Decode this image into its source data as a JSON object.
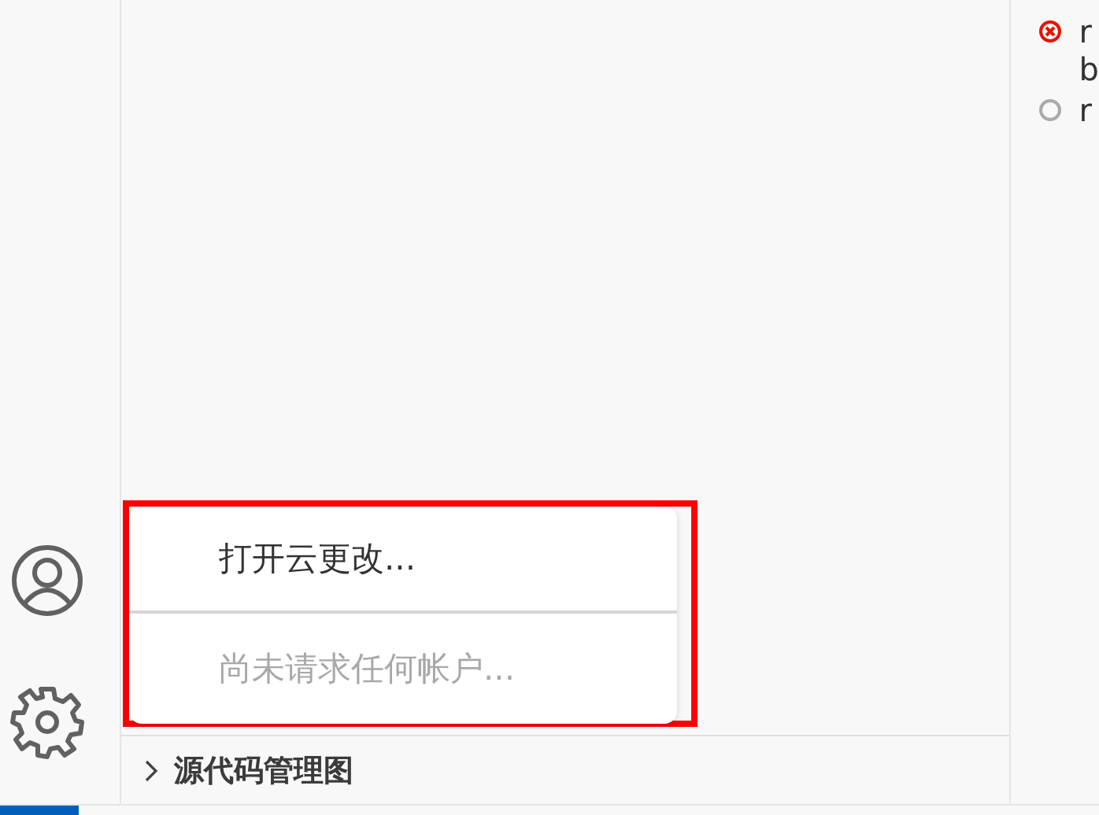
{
  "problems": [
    {
      "kind": "error",
      "lines": [
        "r",
        "b"
      ]
    },
    {
      "kind": "pending",
      "lines": [
        "r"
      ]
    }
  ],
  "section": {
    "title": "源代码管理图",
    "expanded": false
  },
  "accounts_menu": {
    "highlighted": true,
    "items": [
      {
        "label": "打开云更改...",
        "disabled": false
      },
      {
        "label": "尚未请求任何帐户...",
        "disabled": true
      }
    ]
  }
}
